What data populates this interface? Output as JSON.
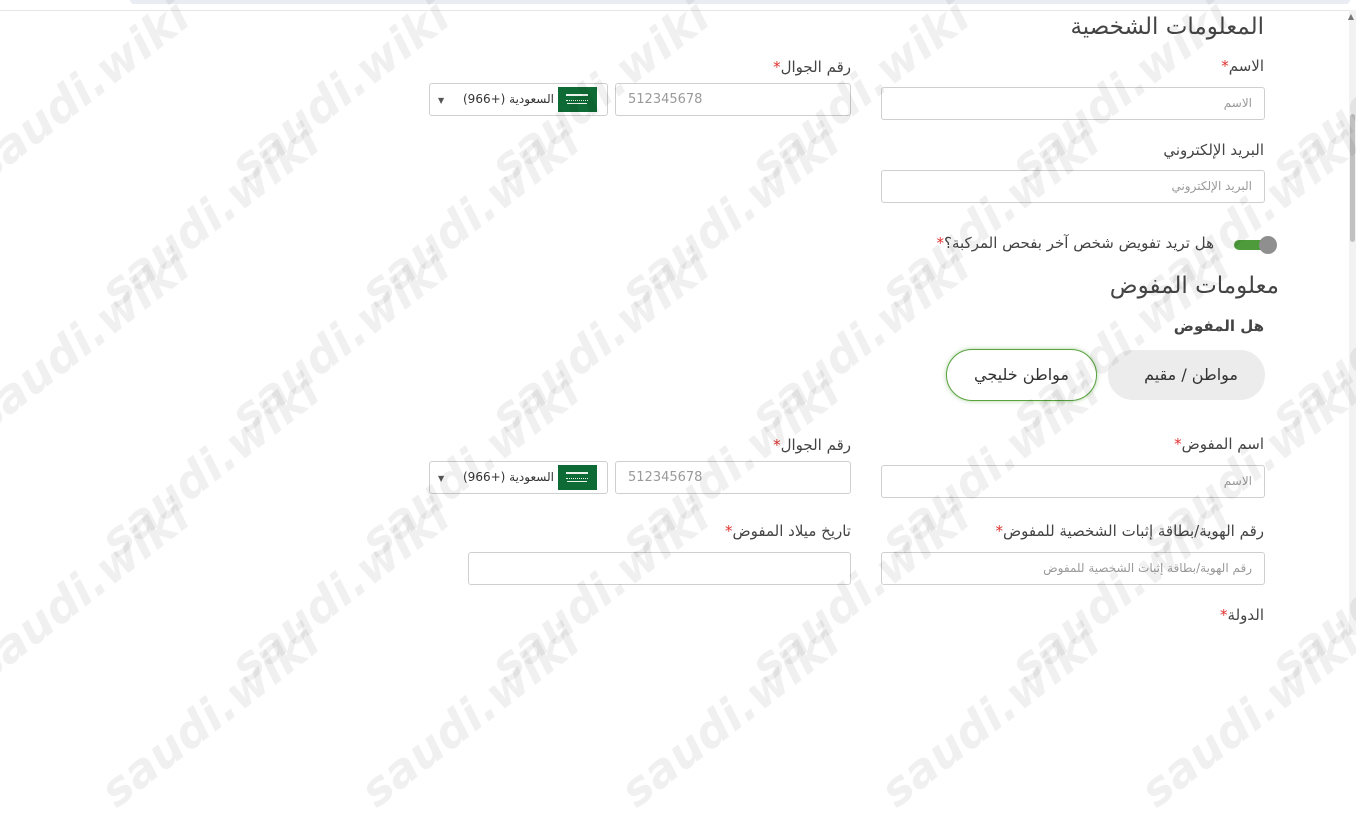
{
  "watermark": "saudi.wiki",
  "personal": {
    "title": "المعلومات الشخصية",
    "name_label": "الاسم",
    "name_placeholder": "الاسم",
    "mobile_label": "رقم الجوال",
    "mobile_placeholder": "512345678",
    "country_code_value": "(966+) السعودية",
    "email_label": "البريد الإلكتروني",
    "email_placeholder": "البريد الإلكتروني"
  },
  "delegate_question": "هل تريد تفويض شخص آخر بفحص المركبة؟",
  "delegate_toggle_on": true,
  "delegate": {
    "title": "معلومات المفوض",
    "type_question": "هل المفوض",
    "option_citizen": "مواطن / مقيم",
    "option_gulf": "مواطن خليجي",
    "selected_option": "مواطن خليجي",
    "name_label": "اسم المفوض",
    "name_placeholder": "الاسم",
    "mobile_label": "رقم الجوال",
    "mobile_placeholder": "512345678",
    "country_code_value": "(966+) السعودية",
    "id_label": "رقم الهوية/بطاقة إثبات الشخصية للمفوض",
    "id_placeholder": "رقم الهوية/بطاقة إثبات الشخصية للمفوض",
    "dob_label": "تاريخ ميلاد المفوض",
    "dob_value": "",
    "country_label": "الدولة"
  },
  "required_mark": "*",
  "colors": {
    "accent": "#4e9b3c",
    "required": "#e0312f",
    "flag": "#0f6b35"
  },
  "icons": [
    "saudi-flag-icon",
    "dropdown-arrow-icon",
    "scroll-up-arrow-icon"
  ]
}
